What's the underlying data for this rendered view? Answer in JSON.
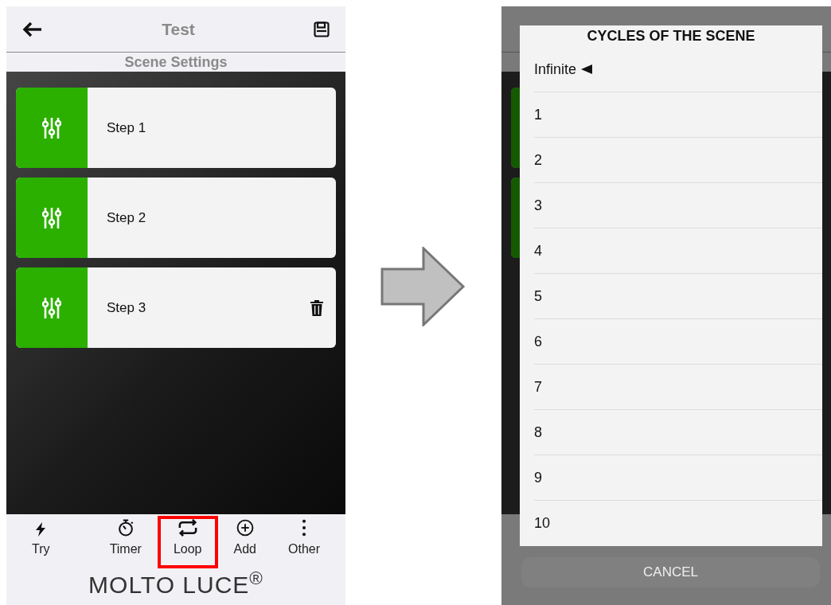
{
  "screen": {
    "title": "Test",
    "subtitle": "Scene Settings"
  },
  "steps": [
    {
      "label": "Step 1",
      "deletable": false
    },
    {
      "label": "Step 2",
      "deletable": false
    },
    {
      "label": "Step 3",
      "deletable": true
    }
  ],
  "toolbar": [
    {
      "label": "Try",
      "kind": "bolt",
      "highlighted": false
    },
    {
      "label": "Timer",
      "kind": "stopwatch",
      "highlighted": false
    },
    {
      "label": "Loop",
      "kind": "repeat",
      "highlighted": true
    },
    {
      "label": "Add",
      "kind": "plus",
      "highlighted": false
    },
    {
      "label": "Other",
      "kind": "more",
      "highlighted": false
    }
  ],
  "logo": "MOLTO LUCE$^{®}$",
  "dialog": {
    "title": "CYCLES OF THE SCENE",
    "options": [
      {
        "label": "Infinite",
        "selected": true
      },
      {
        "label": "1",
        "selected": false
      },
      {
        "label": "2",
        "selected": false
      },
      {
        "label": "3",
        "selected": false
      },
      {
        "label": "4",
        "selected": false
      },
      {
        "label": "5",
        "selected": false
      },
      {
        "label": "6",
        "selected": false
      },
      {
        "label": "7",
        "selected": false
      },
      {
        "label": "8",
        "selected": false
      },
      {
        "label": "9",
        "selected": false
      },
      {
        "label": "10",
        "selected": false
      }
    ],
    "cancel": "CANCEL"
  }
}
